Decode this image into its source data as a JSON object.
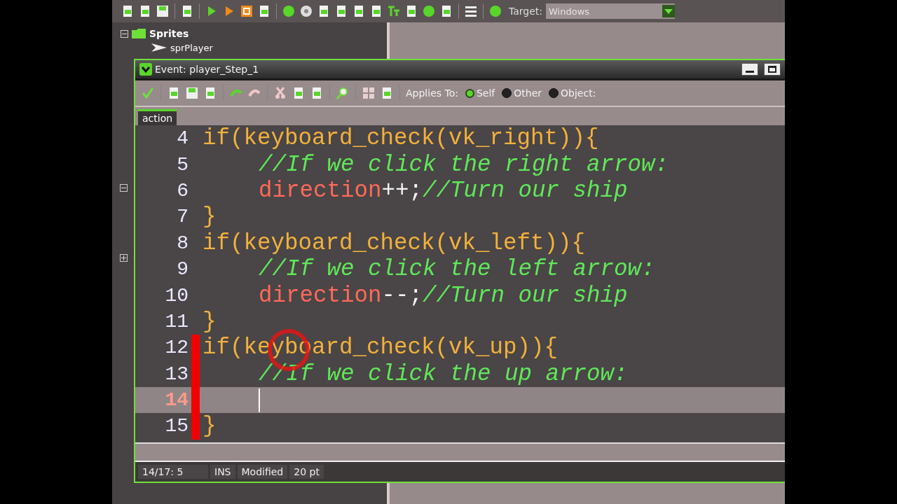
{
  "toolbar": {
    "target_label": "Target:",
    "target_value": "Windows"
  },
  "tree": {
    "group": {
      "label": "Sprites",
      "expanded": true
    },
    "items": [
      {
        "label": "sprPlayer"
      }
    ]
  },
  "event_window": {
    "title": "Event: player_Step_1",
    "applies_to_label": "Applies To:",
    "options": [
      {
        "label": "Self",
        "selected": true
      },
      {
        "label": "Other",
        "selected": false
      },
      {
        "label": "Object:",
        "selected": false
      }
    ],
    "tabs": [
      {
        "label": "action",
        "selected": true
      }
    ],
    "lines": [
      {
        "number": "4",
        "indented": false,
        "changed": false,
        "current": false,
        "tokens": [
          {
            "kind": "code",
            "text": "if(keyboard_check(vk_right)){"
          }
        ]
      },
      {
        "number": "5",
        "indented": true,
        "changed": false,
        "current": false,
        "tokens": [
          {
            "kind": "comment",
            "text": "//If we click the right arrow:"
          }
        ]
      },
      {
        "number": "6",
        "indented": true,
        "changed": false,
        "current": false,
        "tokens": [
          {
            "kind": "var",
            "text": "direction"
          },
          {
            "kind": "op",
            "text": "++;"
          },
          {
            "kind": "comment",
            "text": "//Turn our ship"
          }
        ]
      },
      {
        "number": "7",
        "indented": false,
        "changed": false,
        "current": false,
        "tokens": [
          {
            "kind": "code",
            "text": "}"
          }
        ]
      },
      {
        "number": "8",
        "indented": false,
        "changed": false,
        "current": false,
        "tokens": [
          {
            "kind": "code",
            "text": "if(keyboard_check(vk_left)){"
          }
        ]
      },
      {
        "number": "9",
        "indented": true,
        "changed": false,
        "current": false,
        "tokens": [
          {
            "kind": "comment",
            "text": "//If we click the left arrow:"
          }
        ]
      },
      {
        "number": "10",
        "indented": true,
        "changed": false,
        "current": false,
        "tokens": [
          {
            "kind": "var",
            "text": "direction"
          },
          {
            "kind": "op",
            "text": "--;"
          },
          {
            "kind": "comment",
            "text": "//Turn our ship"
          }
        ]
      },
      {
        "number": "11",
        "indented": false,
        "changed": false,
        "current": false,
        "tokens": [
          {
            "kind": "code",
            "text": "}"
          }
        ]
      },
      {
        "number": "12",
        "indented": false,
        "changed": true,
        "current": false,
        "tokens": [
          {
            "kind": "code",
            "text": "if(keyboard_check(vk_up)){"
          }
        ]
      },
      {
        "number": "13",
        "indented": true,
        "changed": true,
        "current": false,
        "tokens": [
          {
            "kind": "comment",
            "text": "//If we click the up arrow:"
          }
        ]
      },
      {
        "number": "14",
        "indented": true,
        "changed": true,
        "current": true
      },
      {
        "number": "15",
        "indented": false,
        "changed": true,
        "current": false,
        "tokens": [
          {
            "kind": "code",
            "text": "}"
          }
        ]
      }
    ],
    "status": [
      {
        "text": "14/17:  5"
      },
      {
        "text": "INS"
      },
      {
        "text": "Modified"
      },
      {
        "text": "20 pt"
      }
    ]
  }
}
